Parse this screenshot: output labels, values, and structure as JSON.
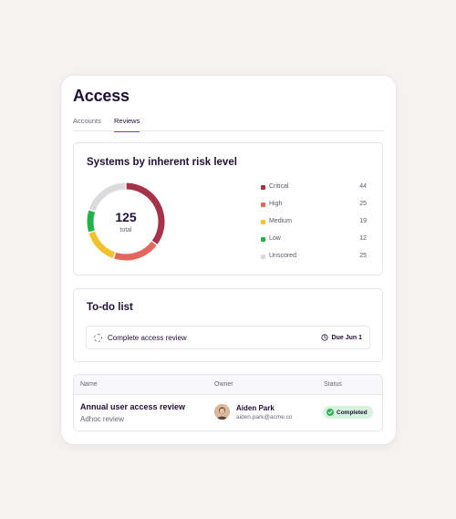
{
  "page": {
    "title": "Access"
  },
  "tabs": [
    {
      "label": "Accounts",
      "active": false
    },
    {
      "label": "Reviews",
      "active": true
    }
  ],
  "risk_panel": {
    "title": "Systems by inherent risk level",
    "total": "125",
    "total_label": "total",
    "legend": [
      {
        "label": "Critical",
        "value": "44",
        "color": "#a8324a"
      },
      {
        "label": "High",
        "value": "25",
        "color": "#e4675e"
      },
      {
        "label": "Medium",
        "value": "19",
        "color": "#f2c12e"
      },
      {
        "label": "Low",
        "value": "12",
        "color": "#24b14a"
      },
      {
        "label": "Unscored",
        "value": "25",
        "color": "#dcdadd"
      }
    ]
  },
  "chart_data": {
    "type": "pie",
    "categories": [
      "Critical",
      "High",
      "Medium",
      "Low",
      "Unscored"
    ],
    "values": [
      44,
      25,
      19,
      12,
      25
    ],
    "colors": [
      "#a8324a",
      "#e4675e",
      "#f2c12e",
      "#24b14a",
      "#dcdadd"
    ],
    "title": "Systems by inherent risk level",
    "legend": "right"
  },
  "todo": {
    "title": "To-do list",
    "items": [
      {
        "label": "Complete access review",
        "due": "Due Jun 1"
      }
    ]
  },
  "table": {
    "columns": [
      "Name",
      "Owner",
      "Status"
    ],
    "rows": [
      {
        "name": "Annual user access review",
        "subtitle": "Adhoc review",
        "owner_name": "Aiden Park",
        "owner_email": "aiden.park@acme.co",
        "status": "Completed"
      }
    ]
  }
}
